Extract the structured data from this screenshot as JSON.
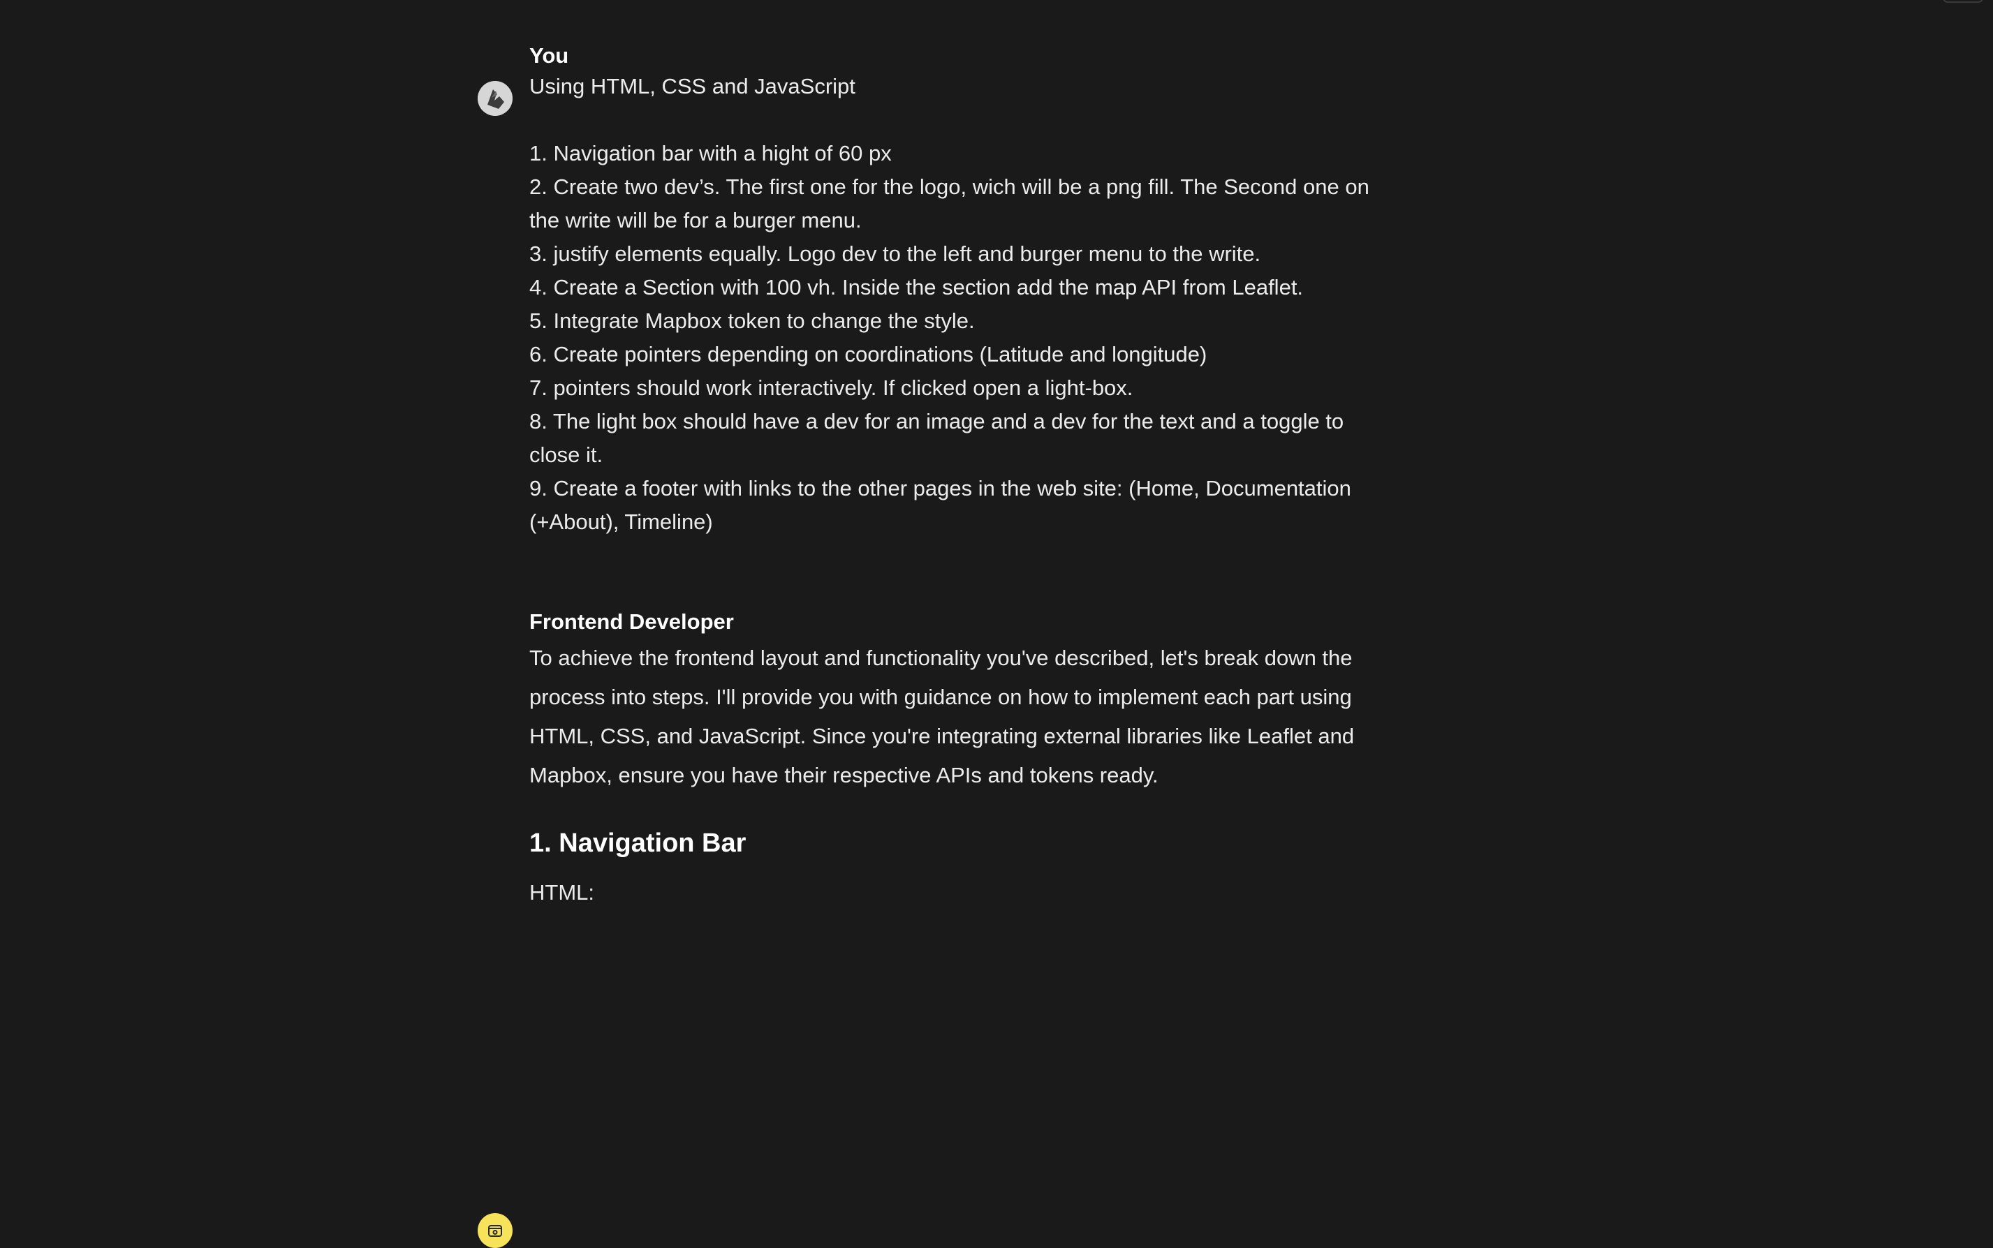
{
  "user_message": {
    "author": "You",
    "lines": [
      "Using HTML, CSS and JavaScript",
      "",
      "1. Navigation bar with a hight of 60 px",
      "2. Create two dev’s. The first one for the logo, wich will be a png fill. The Second one on",
      "the write will be for a burger menu.",
      "3. justify elements equally. Logo dev to the left and burger menu to the write.",
      "4. Create a Section with 100 vh. Inside the section add the map API from Leaflet.",
      "5. Integrate Mapbox token to change the style.",
      "6. Create pointers depending on coordinations (Latitude and longitude)",
      "7. pointers should work interactively. If clicked open a light-box.",
      "8. The light box should have a dev for an image and a dev for the text and a toggle to",
      "close it.",
      "9. Create a footer with links to the other pages in the web site: (Home, Documentation",
      "(+About), Timeline)"
    ]
  },
  "bot_message": {
    "author": "Frontend Developer",
    "paragraph_lines": [
      "To achieve the frontend layout and functionality you've described, let's break down the",
      "process into steps. I'll provide you with guidance on how to implement each part using",
      "HTML, CSS, and JavaScript. Since you're integrating external libraries like Leaflet and",
      "Mapbox, ensure you have their respective APIs and tokens ready."
    ],
    "heading": "1. Navigation Bar",
    "subheading": "HTML:"
  },
  "icons": {
    "user_avatar": "user-avatar-icon",
    "bot_avatar": "bot-avatar-icon"
  },
  "colors": {
    "background": "#1a1a1a",
    "bot_avatar_bg": "#f7e35a",
    "text": "#ececec"
  }
}
